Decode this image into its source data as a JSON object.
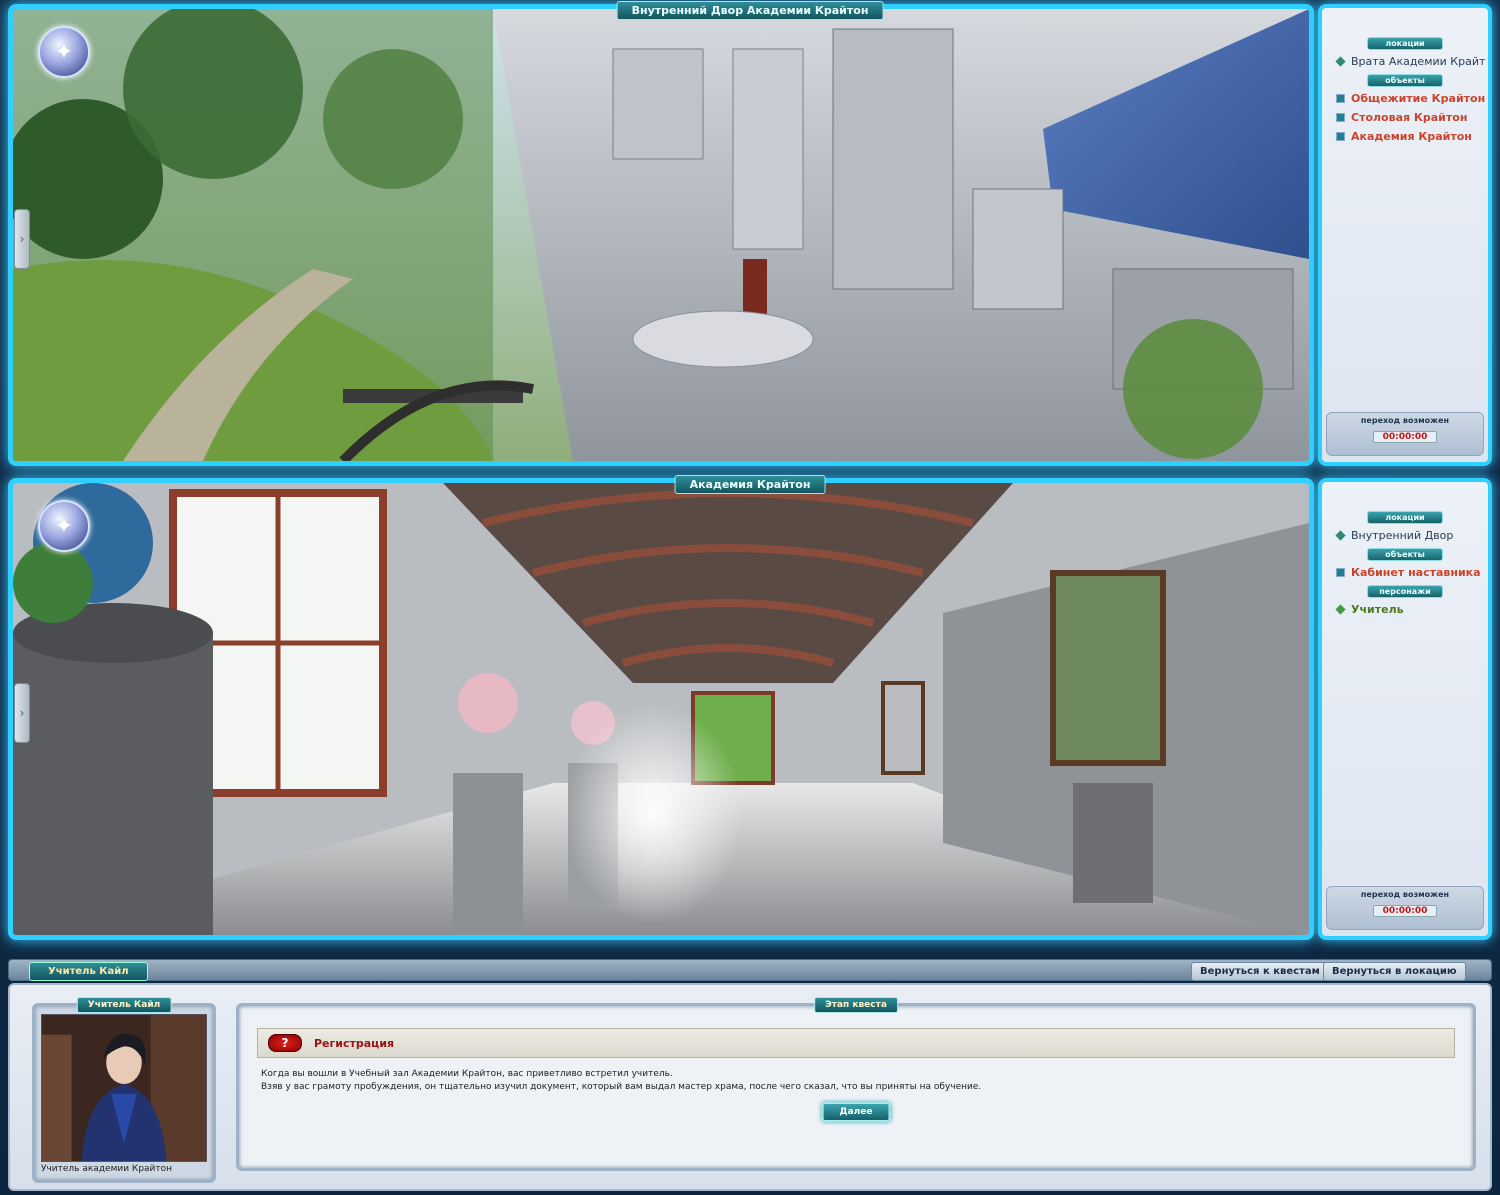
{
  "panels": [
    {
      "title": "Внутренний Двор Академии Крайтон",
      "sections": [
        {
          "header": "локации",
          "type": "loc",
          "items": [
            "Врата Академии Крайт"
          ]
        },
        {
          "header": "объекты",
          "type": "obj",
          "items": [
            "Общежитие Крайтон",
            "Столовая Крайтон",
            "Академия Крайтон"
          ]
        }
      ],
      "transition_label": "переход возможен",
      "timer": "00:00:00"
    },
    {
      "title": "Академия Крайтон",
      "sections": [
        {
          "header": "локации",
          "type": "loc",
          "items": [
            "Внутренний Двор"
          ]
        },
        {
          "header": "объекты",
          "type": "obj",
          "items": [
            "Кабинет наставника"
          ]
        },
        {
          "header": "персонажи",
          "type": "npc",
          "items": [
            "Учитель"
          ]
        }
      ],
      "transition_label": "переход возможен",
      "timer": "00:00:00"
    }
  ],
  "dialog": {
    "tab_name": "Учитель Кайл",
    "back_to_quests": "Вернуться к квестам",
    "back_to_location": "Вернуться в локацию",
    "npc_box_title": "Учитель Кайл",
    "npc_caption": "Учитель академии Крайтон",
    "quest_box_title": "Этап квеста",
    "quest_icon": "?",
    "quest_title": "Регистрация",
    "quest_text_1": "Когда вы вошли в Учебный зал Академии Крайтон, вас приветливо встретил учитель.",
    "quest_text_2": "Взяв у вас грамоту пробуждения, он тщательно изучил документ, который вам выдал мастер храма, после чего сказал, что вы приняты на обучение.",
    "next_label": "Далее"
  },
  "colors": {
    "frame_glow": "#2fd0ff",
    "object_link": "#c9442b",
    "npc_link": "#4f7a1a",
    "timer": "#c51616"
  }
}
